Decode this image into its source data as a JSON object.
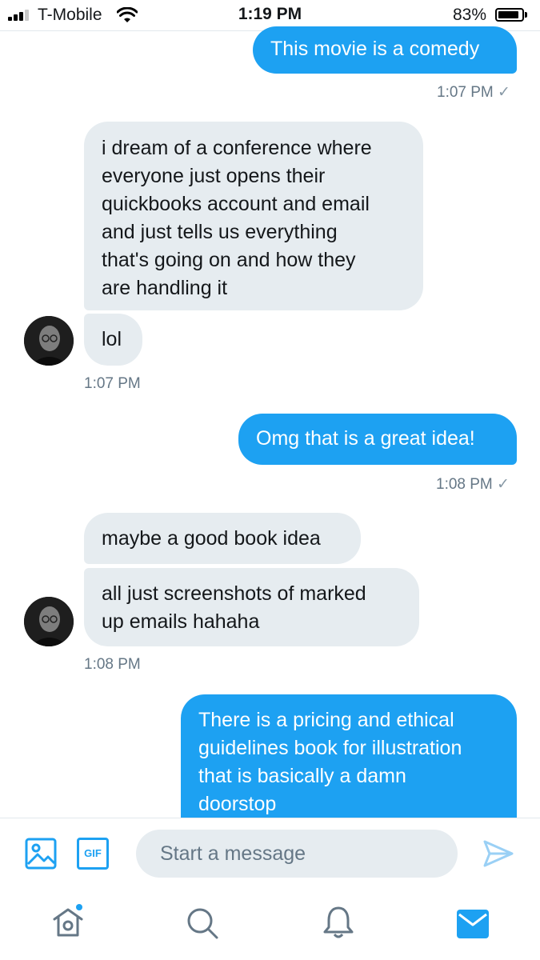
{
  "status_bar": {
    "carrier": "T-Mobile",
    "time": "1:19 PM",
    "battery": "83%",
    "battery_level": 0.83
  },
  "conversation": {
    "m1": {
      "text": "This movie is a comedy",
      "time": "1:07 PM"
    },
    "m2": {
      "line1": "i dream of a conference where",
      "line2": "everyone just opens their",
      "line3": "quickbooks account and email",
      "line4": "and just tells us everything",
      "line5": "that's going on and how they",
      "line6": "are handling it"
    },
    "m3": {
      "text": "lol",
      "time": "1:07 PM"
    },
    "m4": {
      "text": "Omg that is a great idea!",
      "time": "1:08 PM"
    },
    "m5": {
      "text": "maybe a good book idea"
    },
    "m6": {
      "line1": "all just screenshots of marked",
      "line2": "up emails hahaha",
      "time": "1:08 PM"
    },
    "m7": {
      "line1": "There is a pricing and ethical",
      "line2": "guidelines book for illustration",
      "line3": "that is basically a damn",
      "line4": "doorstop"
    },
    "sent_check": "✓"
  },
  "composer": {
    "gif_label": "GIF",
    "placeholder": "Start a message"
  },
  "tabs": [
    "home-icon",
    "search-icon",
    "notifications-icon",
    "messages-icon"
  ],
  "colors": {
    "accent": "#1da1f2",
    "incoming": "#e6ecf0",
    "muted": "#657786"
  }
}
